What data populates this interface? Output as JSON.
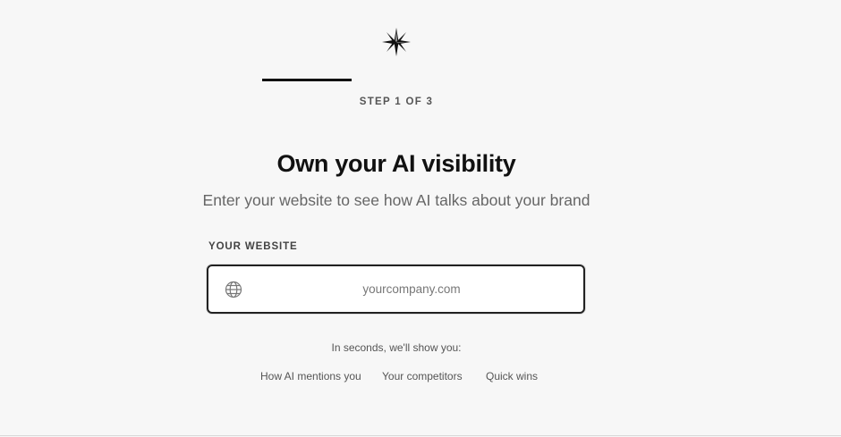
{
  "onboarding": {
    "logo_icon": "compass-star-icon",
    "progress_fraction": 0.3333,
    "step_label": "STEP 1 OF 3",
    "headline": "Own your AI visibility",
    "subheadline": "Enter your website to see how AI talks about your brand",
    "field_label": "YOUR WEBSITE",
    "input": {
      "icon": "globe-icon",
      "value": "",
      "placeholder": "yourcompany.com"
    },
    "promise": "In seconds, we'll show you:",
    "benefits": [
      "How AI mentions you",
      "Your competitors",
      "Quick wins"
    ]
  },
  "colors": {
    "background": "#f7f7f7",
    "text_primary": "#111111",
    "text_muted": "#666666",
    "input_border": "#222222"
  }
}
